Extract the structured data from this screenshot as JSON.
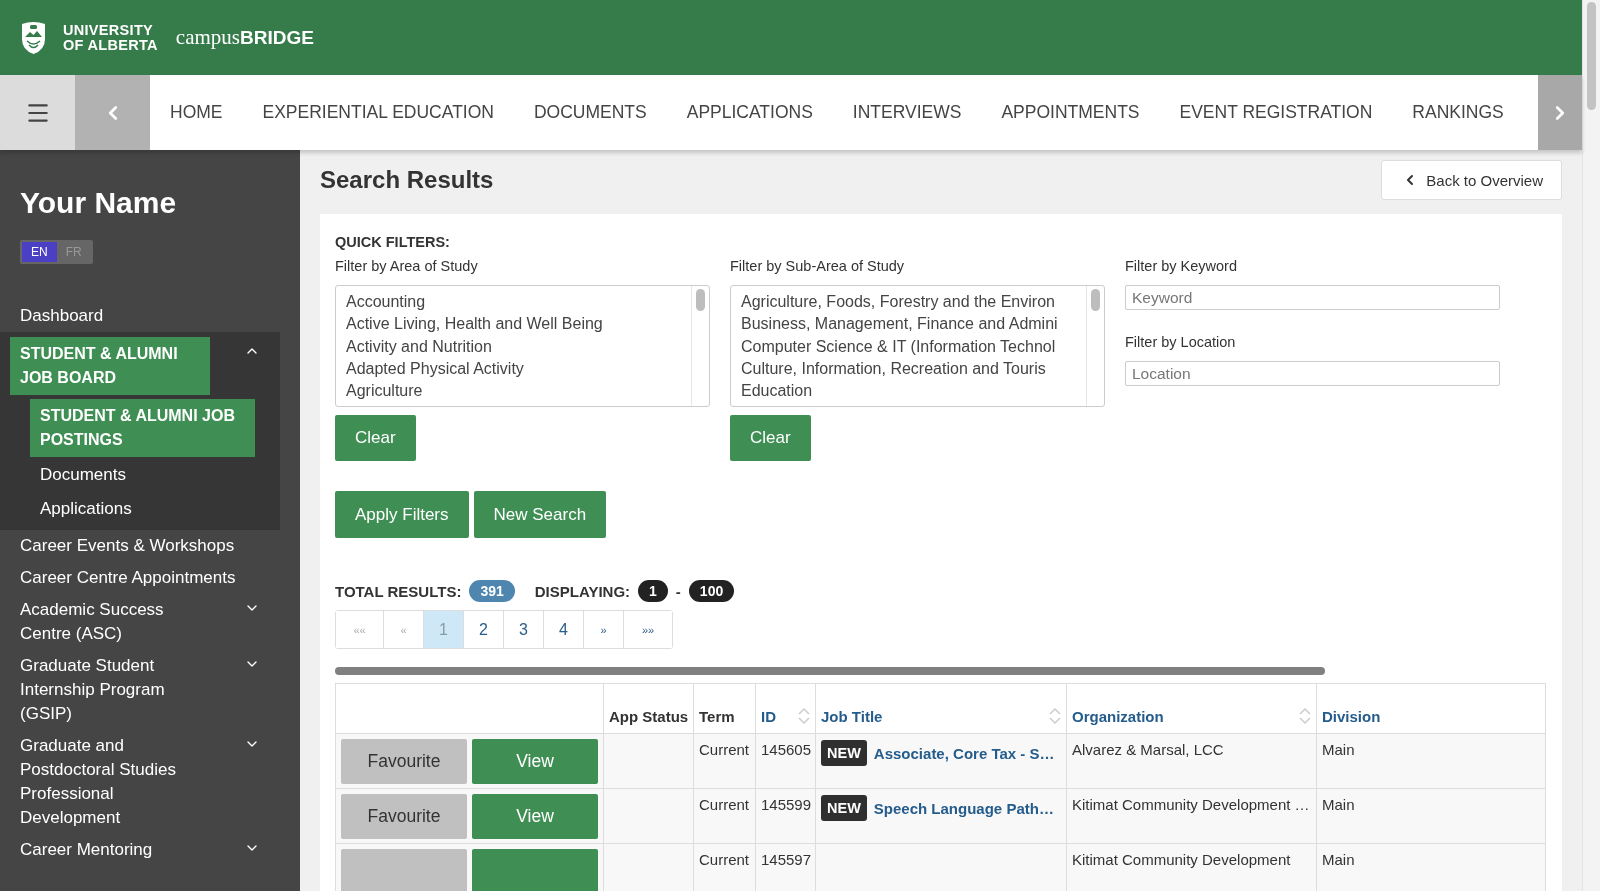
{
  "header": {
    "logo_lines": [
      "UNIVERSITY",
      "OF ALBERTA"
    ],
    "product": "campus**BRIDGE**"
  },
  "nav": {
    "tabs": [
      "HOME",
      "EXPERIENTIAL EDUCATION",
      "DOCUMENTS",
      "APPLICATIONS",
      "INTERVIEWS",
      "APPOINTMENTS",
      "EVENT REGISTRATION",
      "RANKINGS"
    ]
  },
  "sidebar": {
    "user_name": "Your Name",
    "languages": [
      {
        "label": "EN",
        "selected": true
      },
      {
        "label": "FR",
        "selected": false
      }
    ],
    "items": [
      {
        "label": "Dashboard",
        "selected": false,
        "expandable": false
      },
      {
        "label": "STUDENT & ALUMNI JOB BOARD",
        "selected": true,
        "expandable": true,
        "expanded": true,
        "children": [
          {
            "label": "STUDENT & ALUMNI JOB POSTINGS",
            "selected": true
          },
          {
            "label": "Documents",
            "selected": false
          },
          {
            "label": "Applications",
            "selected": false
          }
        ]
      },
      {
        "label": "Career Events & Workshops",
        "selected": false,
        "expandable": false
      },
      {
        "label": "Career Centre Appointments",
        "selected": false,
        "expandable": false
      },
      {
        "label": "Academic Success Centre (ASC)",
        "selected": false,
        "expandable": true,
        "expanded": false
      },
      {
        "label": "Graduate Student Internship Program (GSIP)",
        "selected": false,
        "expandable": true,
        "expanded": false
      },
      {
        "label": "Graduate and Postdoctoral Studies Professional Development",
        "selected": false,
        "expandable": true,
        "expanded": false
      },
      {
        "label": "Career Mentoring",
        "selected": false,
        "expandable": true,
        "expanded": false
      }
    ]
  },
  "page": {
    "title": "Search Results",
    "back_button": "Back to Overview"
  },
  "filters": {
    "heading": "QUICK FILTERS:",
    "lists": [
      {
        "label": "Filter by Area of Study",
        "options": [
          "Accounting",
          "Active Living, Health and Well Being",
          "Activity and Nutrition",
          "Adapted Physical Activity",
          "Agriculture"
        ],
        "clear": "Clear"
      },
      {
        "label": "Filter by Sub-Area of Study",
        "options": [
          "Agriculture, Foods, Forestry and the Environ",
          "Business, Management, Finance and Admini",
          "Computer Science & IT (Information Technol",
          "Culture, Information, Recreation and Touris",
          "Education"
        ],
        "clear": "Clear"
      }
    ],
    "fields": [
      {
        "label": "Filter by Keyword",
        "placeholder": "Keyword"
      },
      {
        "label": "Filter by Location",
        "placeholder": "Location"
      }
    ],
    "buttons": [
      "Apply Filters",
      "New Search"
    ]
  },
  "results": {
    "total_label": "TOTAL RESULTS:",
    "total": "391",
    "displaying_label": "DISPLAYING:",
    "from": "1",
    "separator": "-",
    "to": "100"
  },
  "pagination": [
    {
      "label": "««",
      "selected": false,
      "disabled": true
    },
    {
      "label": "«",
      "selected": false,
      "disabled": true
    },
    {
      "label": "1",
      "selected": true,
      "disabled": false
    },
    {
      "label": "2",
      "selected": false,
      "disabled": false
    },
    {
      "label": "3",
      "selected": false,
      "disabled": false
    },
    {
      "label": "4",
      "selected": false,
      "disabled": false
    },
    {
      "label": "»",
      "selected": false,
      "disabled": false
    },
    {
      "label": "»»",
      "selected": false,
      "disabled": false
    }
  ],
  "table": {
    "columns": [
      {
        "label": "App Status",
        "kind": "plain"
      },
      {
        "label": "Term",
        "kind": "plain"
      },
      {
        "label": "ID",
        "kind": "sortable"
      },
      {
        "label": "Job Title",
        "kind": "sortable"
      },
      {
        "label": "Organization",
        "kind": "sortable"
      },
      {
        "label": "Division",
        "kind": "link"
      }
    ],
    "rows": [
      {
        "favourite": "Favourite",
        "view": "View",
        "term": "Current",
        "id": "145605",
        "badge": "NEW",
        "job_title": "Associate, Core Tax - S…",
        "organization": "Alvarez & Marsal, LCC",
        "division": "Main"
      },
      {
        "favourite": "Favourite",
        "view": "View",
        "term": "Current",
        "id": "145599",
        "badge": "NEW",
        "job_title": "Speech Language Path…",
        "organization": "Kitimat Community Development …",
        "division": "Main"
      },
      {
        "term": "Current",
        "id": "145597",
        "organization": "Kitimat Community Development",
        "division": "Main"
      }
    ]
  }
}
